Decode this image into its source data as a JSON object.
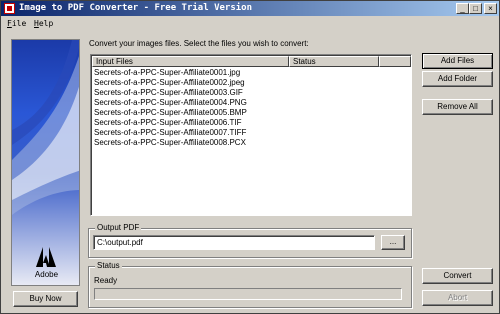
{
  "window": {
    "title": "Image to PDF Converter - Free Trial Version",
    "controls": {
      "minimize": "_",
      "maximize": "□",
      "close": "×"
    }
  },
  "menu": [
    "File",
    "Help"
  ],
  "sidebar": {
    "brand": "Adobe",
    "buy_label": "Buy Now"
  },
  "instruction": "Convert your images files. Select the files you wish to convert:",
  "file_list": {
    "columns": [
      "Input Files",
      "Status"
    ],
    "rows": [
      {
        "name": "Secrets-of-a-PPC-Super-Affiliate0001.jpg",
        "status": ""
      },
      {
        "name": "Secrets-of-a-PPC-Super-Affiliate0002.jpeg",
        "status": ""
      },
      {
        "name": "Secrets-of-a-PPC-Super-Affiliate0003.GIF",
        "status": ""
      },
      {
        "name": "Secrets-of-a-PPC-Super-Affiliate0004.PNG",
        "status": ""
      },
      {
        "name": "Secrets-of-a-PPC-Super-Affiliate0005.BMP",
        "status": ""
      },
      {
        "name": "Secrets-of-a-PPC-Super-Affiliate0006.TIF",
        "status": ""
      },
      {
        "name": "Secrets-of-a-PPC-Super-Affiliate0007.TIFF",
        "status": ""
      },
      {
        "name": "Secrets-of-a-PPC-Super-Affiliate0008.PCX",
        "status": ""
      }
    ]
  },
  "buttons": {
    "add_files": "Add Files",
    "add_folder": "Add Folder",
    "remove_all": "Remove All",
    "convert": "Convert",
    "abort": "Abort"
  },
  "output_pdf": {
    "group_label": "Output PDF",
    "path": "C:\\output.pdf",
    "browse_label": "..."
  },
  "status": {
    "group_label": "Status",
    "text": "Ready",
    "progress": 0
  },
  "colors": {
    "face": "#d4d0c8",
    "title_start": "#0a246a",
    "title_end": "#a6caf0"
  },
  "icons": [
    "app-icon",
    "adobe-logo-icon"
  ]
}
